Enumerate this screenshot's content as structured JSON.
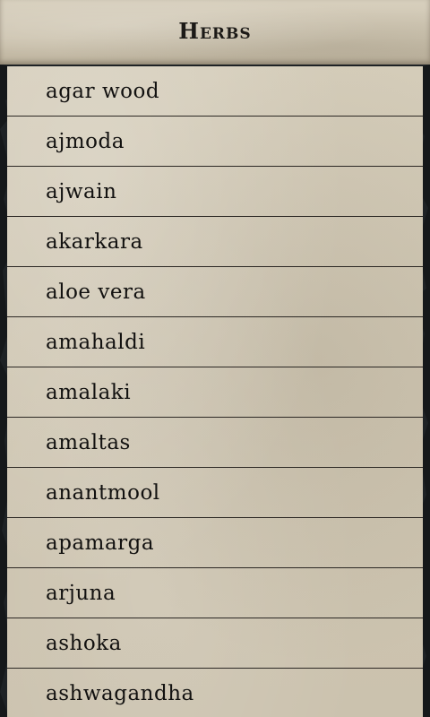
{
  "header": {
    "title": "Herbs"
  },
  "herbs": [
    "agar wood",
    "ajmoda",
    "ajwain",
    "akarkara",
    "aloe vera",
    "amahaldi",
    "amalaki",
    "amaltas",
    "anantmool",
    "apamarga",
    "arjuna",
    "ashoka",
    "ashwagandha"
  ],
  "colors": {
    "parchment": "#d4ccb9",
    "background": "#1e2225",
    "text": "#121110",
    "divider": "#2c2824"
  }
}
